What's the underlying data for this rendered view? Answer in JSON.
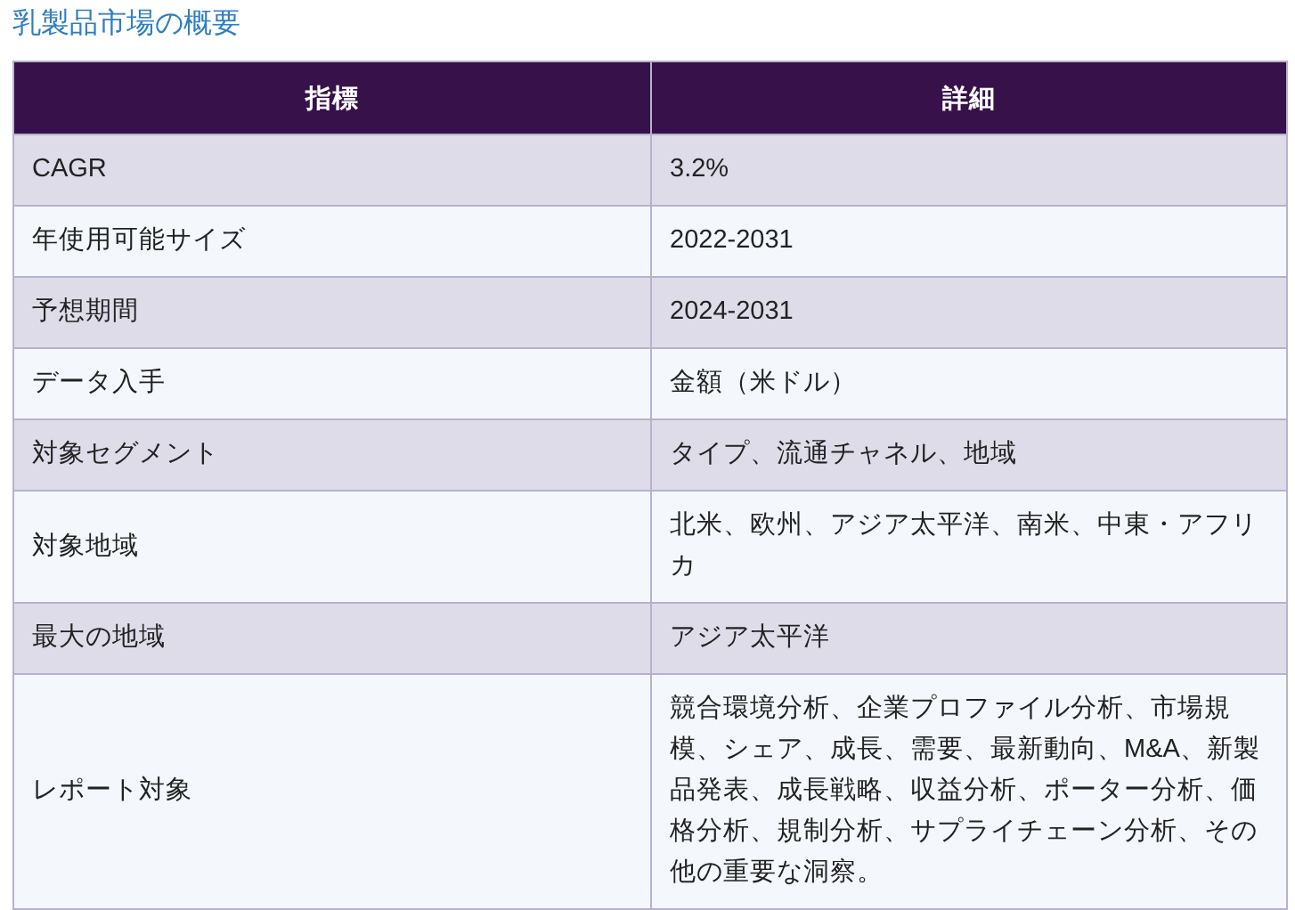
{
  "title": "乳製品市場の概要",
  "table": {
    "columns": [
      "指標",
      "詳細"
    ],
    "rows": [
      [
        "CAGR",
        "3.2%"
      ],
      [
        "年使用可能サイズ",
        "2022-2031"
      ],
      [
        "予想期間",
        "2024-2031"
      ],
      [
        "データ入手",
        "金額（米ドル）"
      ],
      [
        "対象セグメント",
        "タイプ、流通チャネル、地域"
      ],
      [
        "対象地域",
        "北米、欧州、アジア太平洋、南米、中東・アフリカ"
      ],
      [
        "最大の地域",
        "アジア太平洋"
      ],
      [
        "レポート対象",
        "競合環境分析、企業プロファイル分析、市場規模、シェア、成長、需要、最新動向、M&A、新製品発表、成長戦略、収益分析、ポーター分析、価格分析、規制分析、サプライチェーン分析、その他の重要な洞察。"
      ]
    ]
  }
}
